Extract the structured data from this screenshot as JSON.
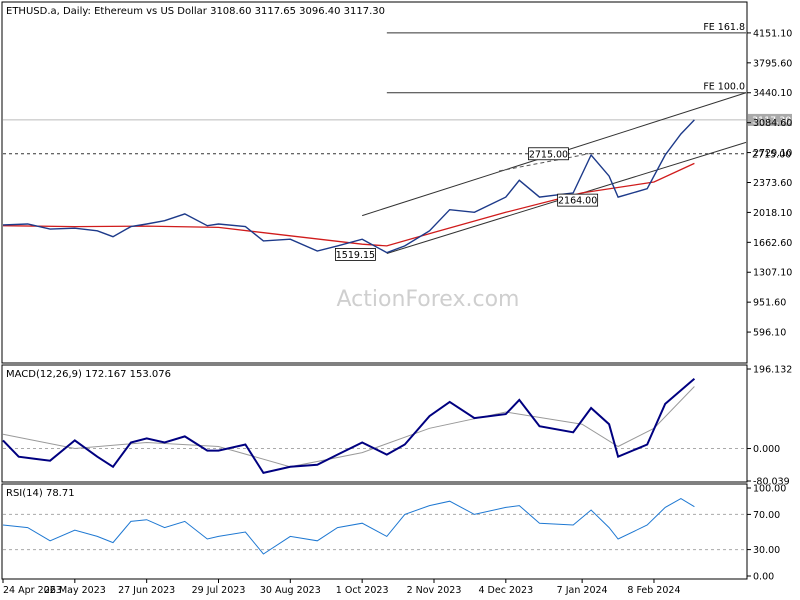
{
  "chart_data": [
    {
      "panel": "price",
      "type": "ohlc",
      "title": "ETHUSD.a, Daily:  Ethereum vs US Dollar  3108.60 3117.65 3096.40 3117.30",
      "watermark": "ActionForex.com",
      "ylim": [
        240.5,
        4506.6
      ],
      "y_ticks": [
        {
          "value": 4151.1,
          "label": "4151.10"
        },
        {
          "value": 3795.6,
          "label": "3795.60"
        },
        {
          "value": 3440.1,
          "label": "3440.10"
        },
        {
          "value": 3084.6,
          "label": "3084.60"
        },
        {
          "value": 2729.1,
          "label": "2729.10"
        },
        {
          "value": 2373.6,
          "label": "2373.60"
        },
        {
          "value": 2018.1,
          "label": "2018.10"
        },
        {
          "value": 1662.6,
          "label": "1662.60"
        },
        {
          "value": 1307.1,
          "label": "1307.10"
        },
        {
          "value": 951.6,
          "label": "951.60"
        },
        {
          "value": 596.1,
          "label": "596.10"
        }
      ],
      "x_ticks": [
        "24 Apr 2023",
        "26 May 2023",
        "27 Jun 2023",
        "29 Jul 2023",
        "30 Aug 2023",
        "1 Oct 2023",
        "2 Nov 2023",
        "4 Dec 2023",
        "7 Jan 2024",
        "8 Feb 2024"
      ],
      "price_series": [
        {
          "date": "2023-04-24",
          "value": 1870
        },
        {
          "date": "2023-05-05",
          "value": 1880
        },
        {
          "date": "2023-05-15",
          "value": 1820
        },
        {
          "date": "2023-05-26",
          "value": 1830
        },
        {
          "date": "2023-06-05",
          "value": 1800
        },
        {
          "date": "2023-06-12",
          "value": 1730
        },
        {
          "date": "2023-06-20",
          "value": 1850
        },
        {
          "date": "2023-06-27",
          "value": 1880
        },
        {
          "date": "2023-07-05",
          "value": 1920
        },
        {
          "date": "2023-07-14",
          "value": 2000
        },
        {
          "date": "2023-07-24",
          "value": 1860
        },
        {
          "date": "2023-07-29",
          "value": 1880
        },
        {
          "date": "2023-08-10",
          "value": 1850
        },
        {
          "date": "2023-08-18",
          "value": 1680
        },
        {
          "date": "2023-08-30",
          "value": 1700
        },
        {
          "date": "2023-09-11",
          "value": 1560
        },
        {
          "date": "2023-09-20",
          "value": 1620
        },
        {
          "date": "2023-10-01",
          "value": 1700
        },
        {
          "date": "2023-10-12",
          "value": 1540
        },
        {
          "date": "2023-10-20",
          "value": 1620
        },
        {
          "date": "2023-10-31",
          "value": 1800
        },
        {
          "date": "2023-11-09",
          "value": 2050
        },
        {
          "date": "2023-11-20",
          "value": 2020
        },
        {
          "date": "2023-12-04",
          "value": 2200
        },
        {
          "date": "2023-12-10",
          "value": 2400
        },
        {
          "date": "2023-12-19",
          "value": 2200
        },
        {
          "date": "2024-01-03",
          "value": 2250
        },
        {
          "date": "2024-01-11",
          "value": 2700
        },
        {
          "date": "2024-01-19",
          "value": 2450
        },
        {
          "date": "2024-01-23",
          "value": 2200
        },
        {
          "date": "2024-02-05",
          "value": 2300
        },
        {
          "date": "2024-02-13",
          "value": 2700
        },
        {
          "date": "2024-02-20",
          "value": 2950
        },
        {
          "date": "2024-02-26",
          "value": 3117.3
        }
      ],
      "ma_series": [
        {
          "date": "2023-04-24",
          "value": 1860
        },
        {
          "date": "2023-05-26",
          "value": 1850
        },
        {
          "date": "2023-06-27",
          "value": 1855
        },
        {
          "date": "2023-07-29",
          "value": 1840
        },
        {
          "date": "2023-08-30",
          "value": 1740
        },
        {
          "date": "2023-10-01",
          "value": 1640
        },
        {
          "date": "2023-10-12",
          "value": 1620
        },
        {
          "date": "2023-11-02",
          "value": 1780
        },
        {
          "date": "2023-12-04",
          "value": 2020
        },
        {
          "date": "2024-01-07",
          "value": 2250
        },
        {
          "date": "2024-02-08",
          "value": 2380
        },
        {
          "date": "2024-02-26",
          "value": 2600
        }
      ],
      "trend_lines": [
        {
          "from": {
            "date": "2023-10-01",
            "value": 1980
          },
          "to": {
            "date": "2024-03-20",
            "value": 3440
          }
        },
        {
          "from": {
            "date": "2023-10-12",
            "value": 1530
          },
          "to": {
            "date": "2024-03-20",
            "value": 2850
          }
        }
      ],
      "fib_projection": {
        "from": {
          "date": "2023-12-01",
          "value": 2510
        },
        "to": {
          "date": "2024-01-11",
          "value": 2720
        }
      },
      "levels": [
        {
          "value": 4151.1,
          "label": "FE 161.8",
          "from_date": "2023-10-12",
          "to_date": "2024-03-20"
        },
        {
          "value": 3440.1,
          "label": "FE 100.0",
          "from_date": "2023-10-12",
          "to_date": "2024-03-20"
        },
        {
          "value": 2715.0,
          "label": "2715.00",
          "style": "dashed"
        },
        {
          "value": 3117.3,
          "label": "3117.30",
          "style": "current"
        }
      ],
      "callouts": [
        {
          "label": "2715.00",
          "date": "2023-12-23",
          "value": 2715
        },
        {
          "label": "2164.00",
          "date": "2024-01-05",
          "value": 2164
        },
        {
          "label": "1519.15",
          "date": "2023-09-28",
          "value": 1519.15
        }
      ],
      "colors": {
        "price": "#1d3a8a",
        "ma": "#d01c1c",
        "line": "#333333",
        "current_tag": "#a9a9a9",
        "tag_text": "#ffffff"
      }
    },
    {
      "panel": "macd",
      "type": "line",
      "title": "MACD(12,26,9) 172.167 153.076",
      "ylim": [
        -80.039,
        196.132
      ],
      "y_ticks": [
        {
          "value": 196.132,
          "label": "196.132"
        },
        {
          "value": 0.0,
          "label": "0.000"
        },
        {
          "value": -80.039,
          "label": "-80.039"
        }
      ],
      "macd_series": [
        {
          "date": "2023-04-24",
          "value": 20
        },
        {
          "date": "2023-05-01",
          "value": -20
        },
        {
          "date": "2023-05-08",
          "value": -25
        },
        {
          "date": "2023-05-15",
          "value": -30
        },
        {
          "date": "2023-05-26",
          "value": 20
        },
        {
          "date": "2023-06-05",
          "value": -20
        },
        {
          "date": "2023-06-12",
          "value": -45
        },
        {
          "date": "2023-06-20",
          "value": 15
        },
        {
          "date": "2023-06-27",
          "value": 25
        },
        {
          "date": "2023-07-05",
          "value": 15
        },
        {
          "date": "2023-07-14",
          "value": 30
        },
        {
          "date": "2023-07-24",
          "value": -5
        },
        {
          "date": "2023-07-29",
          "value": -5
        },
        {
          "date": "2023-08-10",
          "value": 10
        },
        {
          "date": "2023-08-18",
          "value": -60
        },
        {
          "date": "2023-08-30",
          "value": -45
        },
        {
          "date": "2023-09-11",
          "value": -40
        },
        {
          "date": "2023-09-20",
          "value": -15
        },
        {
          "date": "2023-10-01",
          "value": 15
        },
        {
          "date": "2023-10-12",
          "value": -15
        },
        {
          "date": "2023-10-20",
          "value": 10
        },
        {
          "date": "2023-10-31",
          "value": 80
        },
        {
          "date": "2023-11-09",
          "value": 115
        },
        {
          "date": "2023-11-20",
          "value": 75
        },
        {
          "date": "2023-12-04",
          "value": 85
        },
        {
          "date": "2023-12-10",
          "value": 120
        },
        {
          "date": "2023-12-19",
          "value": 55
        },
        {
          "date": "2024-01-03",
          "value": 40
        },
        {
          "date": "2024-01-11",
          "value": 100
        },
        {
          "date": "2024-01-19",
          "value": 60
        },
        {
          "date": "2024-01-23",
          "value": -20
        },
        {
          "date": "2024-02-05",
          "value": 10
        },
        {
          "date": "2024-02-13",
          "value": 110
        },
        {
          "date": "2024-02-26",
          "value": 172.167
        }
      ],
      "signal_series": [
        {
          "date": "2023-04-24",
          "value": 35
        },
        {
          "date": "2023-05-26",
          "value": 0
        },
        {
          "date": "2023-06-27",
          "value": 15
        },
        {
          "date": "2023-07-29",
          "value": 5
        },
        {
          "date": "2023-08-30",
          "value": -45
        },
        {
          "date": "2023-10-01",
          "value": -10
        },
        {
          "date": "2023-10-31",
          "value": 50
        },
        {
          "date": "2023-12-04",
          "value": 90
        },
        {
          "date": "2024-01-07",
          "value": 60
        },
        {
          "date": "2024-01-23",
          "value": 5
        },
        {
          "date": "2024-02-08",
          "value": 50
        },
        {
          "date": "2024-02-26",
          "value": 153.076
        }
      ],
      "colors": {
        "macd": "#000080",
        "signal": "#9a9a9a",
        "zero": "#aaaaaa"
      }
    },
    {
      "panel": "rsi",
      "type": "line",
      "title": "RSI(14) 78.71",
      "ylim": [
        0,
        100
      ],
      "y_ticks": [
        {
          "value": 100,
          "label": "100.00"
        },
        {
          "value": 70,
          "label": "70.00"
        },
        {
          "value": 30,
          "label": "30.00"
        },
        {
          "value": 0,
          "label": "0.00"
        }
      ],
      "rsi_series": [
        {
          "date": "2023-04-24",
          "value": 58
        },
        {
          "date": "2023-05-05",
          "value": 55
        },
        {
          "date": "2023-05-15",
          "value": 40
        },
        {
          "date": "2023-05-26",
          "value": 52
        },
        {
          "date": "2023-06-05",
          "value": 45
        },
        {
          "date": "2023-06-12",
          "value": 38
        },
        {
          "date": "2023-06-20",
          "value": 62
        },
        {
          "date": "2023-06-27",
          "value": 64
        },
        {
          "date": "2023-07-05",
          "value": 55
        },
        {
          "date": "2023-07-14",
          "value": 62
        },
        {
          "date": "2023-07-24",
          "value": 42
        },
        {
          "date": "2023-07-29",
          "value": 45
        },
        {
          "date": "2023-08-10",
          "value": 50
        },
        {
          "date": "2023-08-18",
          "value": 25
        },
        {
          "date": "2023-08-30",
          "value": 45
        },
        {
          "date": "2023-09-11",
          "value": 40
        },
        {
          "date": "2023-09-20",
          "value": 55
        },
        {
          "date": "2023-10-01",
          "value": 60
        },
        {
          "date": "2023-10-12",
          "value": 45
        },
        {
          "date": "2023-10-20",
          "value": 70
        },
        {
          "date": "2023-10-31",
          "value": 80
        },
        {
          "date": "2023-11-09",
          "value": 85
        },
        {
          "date": "2023-11-20",
          "value": 70
        },
        {
          "date": "2023-12-04",
          "value": 78
        },
        {
          "date": "2023-12-10",
          "value": 80
        },
        {
          "date": "2023-12-19",
          "value": 60
        },
        {
          "date": "2024-01-03",
          "value": 58
        },
        {
          "date": "2024-01-11",
          "value": 75
        },
        {
          "date": "2024-01-19",
          "value": 55
        },
        {
          "date": "2024-01-23",
          "value": 42
        },
        {
          "date": "2024-02-05",
          "value": 58
        },
        {
          "date": "2024-02-13",
          "value": 78
        },
        {
          "date": "2024-02-20",
          "value": 88
        },
        {
          "date": "2024-02-26",
          "value": 78.71
        }
      ],
      "colors": {
        "rsi": "#1e78d2",
        "level": "#aaaaaa"
      }
    }
  ]
}
